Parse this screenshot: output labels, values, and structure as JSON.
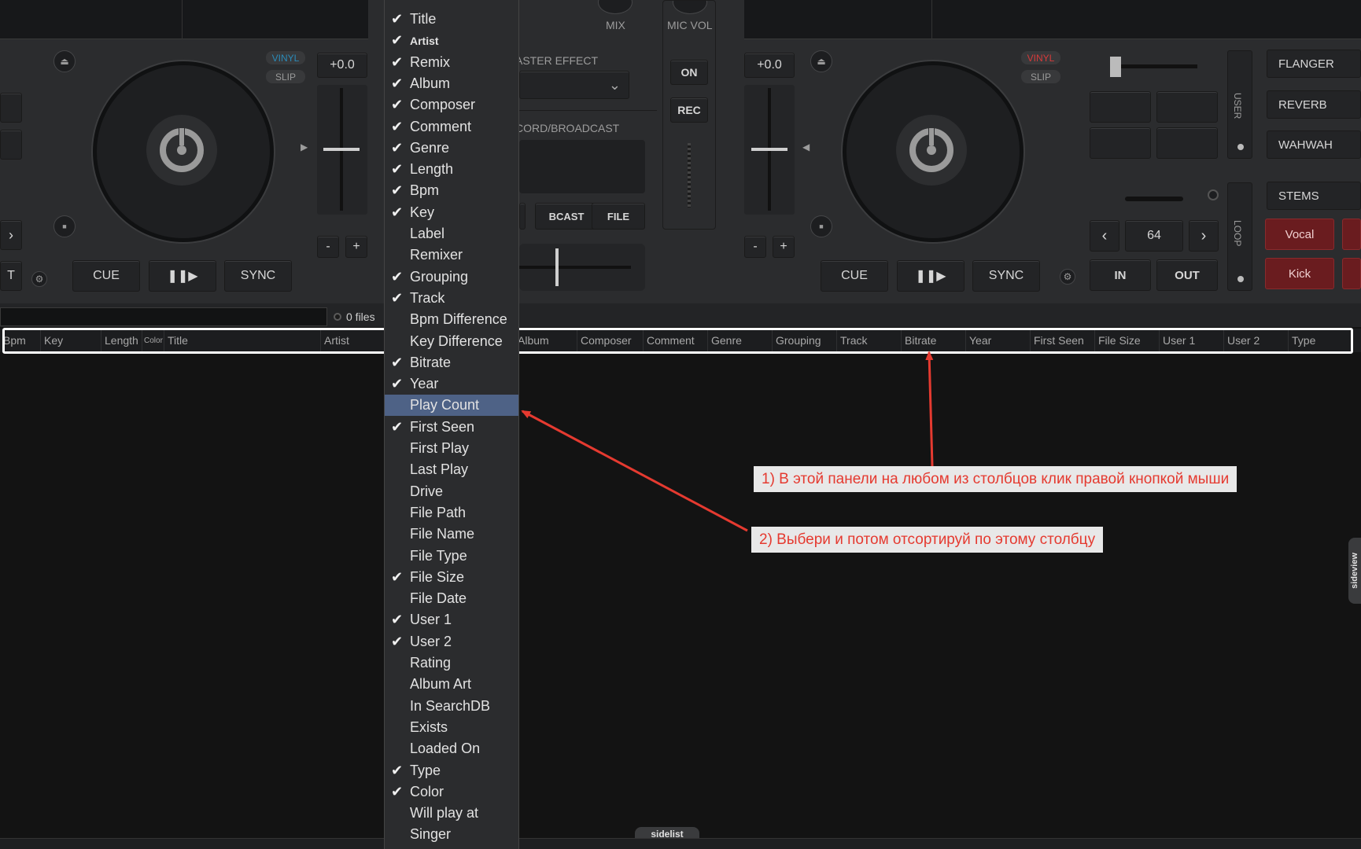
{
  "left_deck": {
    "vinyl": "VINYL",
    "slip": "SLIP",
    "pitch": "+0.0",
    "minus": "-",
    "plus": "+",
    "cue": "CUE",
    "play": "❚❚▶",
    "sync": "SYNC",
    "edge_label": "T"
  },
  "mixer": {
    "mix": "MIX",
    "mic_vol": "MIC VOL",
    "master_effect": "ASTER EFFECT",
    "on": "ON",
    "rec": "REC",
    "record_broadcast": "CORD/BROADCAST",
    "bcast": "BCAST",
    "file": "FILE"
  },
  "right_deck": {
    "vinyl": "VINYL",
    "slip": "SLIP",
    "pitch": "+0.0",
    "minus": "-",
    "plus": "+",
    "cue": "CUE",
    "play": "❚❚▶",
    "sync": "SYNC",
    "user": "USER",
    "loop": "LOOP",
    "loop_size": "64",
    "in": "IN",
    "out": "OUT",
    "effects": [
      "FLANGER",
      "REVERB",
      "WAHWAH"
    ],
    "stems": "STEMS",
    "stem_vocal": "Vocal",
    "stem_kick": "Kick"
  },
  "browser": {
    "files_count": "0 files",
    "columns": [
      "Bpm",
      "Key",
      "Length",
      "Color",
      "Title",
      "Artist",
      "Album",
      "Composer",
      "Comment",
      "Genre",
      "Grouping",
      "Track",
      "Bitrate",
      "Year",
      "First Seen",
      "File Size",
      "User 1",
      "User 2",
      "Type"
    ]
  },
  "context_menu": {
    "items": [
      {
        "label": "Title",
        "checked": true
      },
      {
        "label": "Artist",
        "checked": true
      },
      {
        "label": "Remix",
        "checked": true
      },
      {
        "label": "Album",
        "checked": true
      },
      {
        "label": "Composer",
        "checked": true
      },
      {
        "label": "Comment",
        "checked": true
      },
      {
        "label": "Genre",
        "checked": true
      },
      {
        "label": "Length",
        "checked": true
      },
      {
        "label": "Bpm",
        "checked": true
      },
      {
        "label": "Key",
        "checked": true
      },
      {
        "label": "Label",
        "checked": false
      },
      {
        "label": "Remixer",
        "checked": false
      },
      {
        "label": "Grouping",
        "checked": true
      },
      {
        "label": "Track",
        "checked": true
      },
      {
        "label": "Bpm Difference",
        "checked": false
      },
      {
        "label": "Key Difference",
        "checked": false
      },
      {
        "label": "Bitrate",
        "checked": true
      },
      {
        "label": "Year",
        "checked": true
      },
      {
        "label": "Play Count",
        "checked": false,
        "selected": true
      },
      {
        "label": "First Seen",
        "checked": true
      },
      {
        "label": "First Play",
        "checked": false
      },
      {
        "label": "Last Play",
        "checked": false
      },
      {
        "label": "Drive",
        "checked": false
      },
      {
        "label": "File Path",
        "checked": false
      },
      {
        "label": "File Name",
        "checked": false
      },
      {
        "label": "File Type",
        "checked": false
      },
      {
        "label": "File Size",
        "checked": true
      },
      {
        "label": "File Date",
        "checked": false
      },
      {
        "label": "User 1",
        "checked": true
      },
      {
        "label": "User 2",
        "checked": true
      },
      {
        "label": "Rating",
        "checked": false
      },
      {
        "label": "Album Art",
        "checked": false
      },
      {
        "label": "In SearchDB",
        "checked": false
      },
      {
        "label": "Exists",
        "checked": false
      },
      {
        "label": "Loaded On",
        "checked": false
      },
      {
        "label": "Type",
        "checked": true
      },
      {
        "label": "Color",
        "checked": true
      },
      {
        "label": "Will play at",
        "checked": false
      },
      {
        "label": "Singer",
        "checked": false
      }
    ],
    "check_glyph": "✔"
  },
  "annotations": {
    "note1": "1) В этой панели на любом из столбцов клик правой кнопкой мыши",
    "note2": "2) Выбери и потом отсортируй по этому столбцу"
  },
  "tabs": {
    "sidelist": "sidelist",
    "sideview": "sideview"
  },
  "colors": {
    "menu_selected": "#4e6286",
    "annotation_red": "#e53a30",
    "stem_red": "#6a1c1f",
    "vinyl_blue": "#2a8ab8",
    "vinyl_red": "#d63a3a"
  }
}
